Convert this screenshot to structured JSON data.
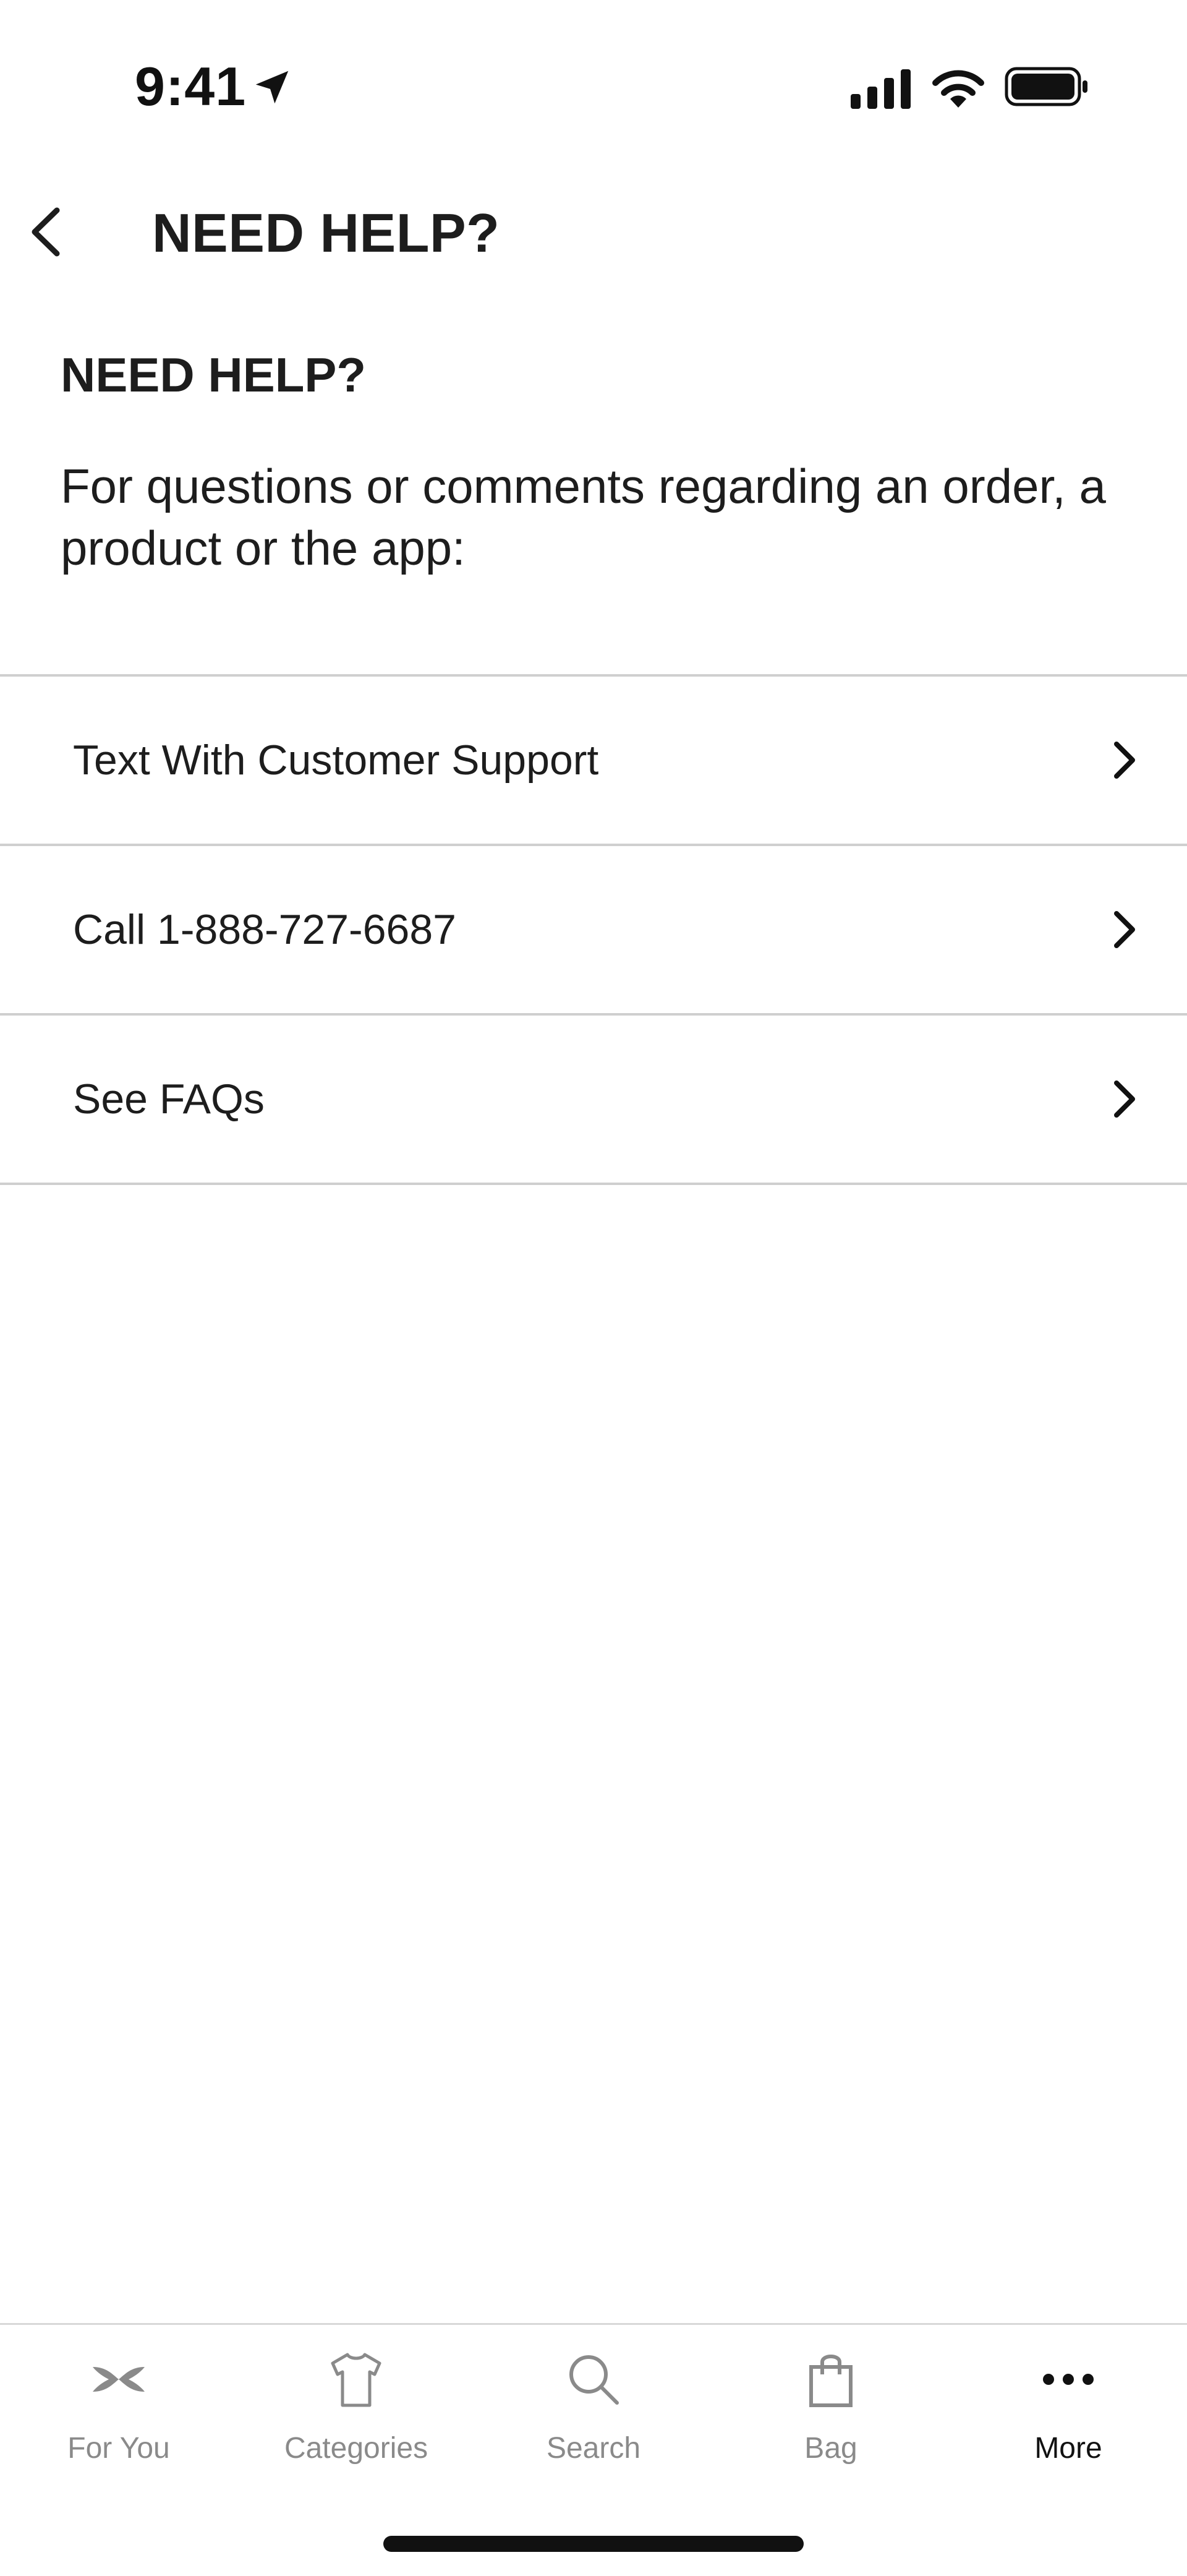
{
  "status_bar": {
    "time": "9:41",
    "icons": [
      "location-arrow-icon",
      "cellular-signal-icon",
      "wifi-icon",
      "battery-icon"
    ]
  },
  "header": {
    "title": "NEED HELP?",
    "back_icon": "chevron-left-icon"
  },
  "intro": {
    "heading": "NEED HELP?",
    "description": "For questions or comments regarding an order, a product or the app:"
  },
  "options": [
    {
      "label": "Text With Customer Support",
      "icon": "chevron-right-icon"
    },
    {
      "label": "Call 1-888-727-6687",
      "icon": "chevron-right-icon"
    },
    {
      "label": "See FAQs",
      "icon": "chevron-right-icon"
    }
  ],
  "tab_bar": {
    "items": [
      {
        "label": "For You",
        "icon": "brand-logo-icon",
        "active": false
      },
      {
        "label": "Categories",
        "icon": "shirt-icon",
        "active": false
      },
      {
        "label": "Search",
        "icon": "search-icon",
        "active": false
      },
      {
        "label": "Bag",
        "icon": "shopping-bag-icon",
        "active": false
      },
      {
        "label": "More",
        "icon": "more-dots-icon",
        "active": true
      }
    ]
  },
  "colors": {
    "text_primary": "#1d1d1d",
    "tab_inactive": "#8a8a8a",
    "tab_active": "#111111",
    "divider": "#cfcfcf",
    "background": "#ffffff"
  }
}
